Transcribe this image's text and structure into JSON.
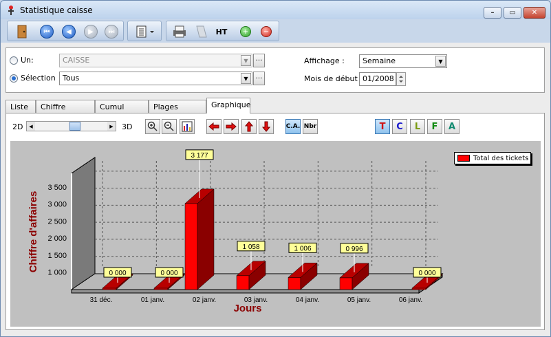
{
  "window": {
    "title": "Statistique caisse"
  },
  "filters": {
    "un_label": "Un:",
    "un_value": "CAISSE",
    "selection_label": "Sélection",
    "selection_value": "Tous",
    "affichage_label": "Affichage :",
    "affichage_value": "Semaine",
    "mois_label": "Mois de début :",
    "mois_value": "01/2008"
  },
  "tabs": [
    {
      "label": "Liste"
    },
    {
      "label": "Chiffre d'affaires"
    },
    {
      "label": "Cumul Articles"
    },
    {
      "label": "Plages horaires"
    },
    {
      "label": "Graphique"
    }
  ],
  "chart_toolbar": {
    "label_2d": "2D",
    "label_3d": "3D",
    "depth_level": 0.55,
    "ca_label": "C.A.",
    "nbr_label": "Nbr",
    "letters": [
      "T",
      "C",
      "L",
      "F",
      "A"
    ],
    "letter_colors": [
      "#d01010",
      "#1a1acc",
      "#7a9a10",
      "#108a10",
      "#108a70"
    ]
  },
  "toolbar": {
    "ht_label": "HT"
  },
  "chart_data": {
    "type": "bar",
    "categories": [
      "31 déc.",
      "01 janv.",
      "02 janv.",
      "03 janv.",
      "04 janv.",
      "05 janv.",
      "06 janv."
    ],
    "series": [
      {
        "name": "Total des tickets",
        "values": [
          0,
          0,
          3177,
          1058,
          1006,
          996,
          0
        ],
        "color": "#ff0000"
      }
    ],
    "data_labels": [
      "0 000",
      "0 000",
      "3 177",
      "1 058",
      "1 006",
      "0 996",
      "0 000"
    ],
    "xlabel": "Jours",
    "ylabel": "Chiffre d'affaires",
    "yticks": [
      "1 000",
      "1 500",
      "2 000",
      "2 500",
      "3 000",
      "3 500"
    ],
    "ytick_values": [
      1000,
      1500,
      2000,
      2500,
      3000,
      3500
    ],
    "ylim": [
      650,
      3700
    ],
    "grid": true,
    "legend_position": "top-right",
    "view": "3d"
  }
}
